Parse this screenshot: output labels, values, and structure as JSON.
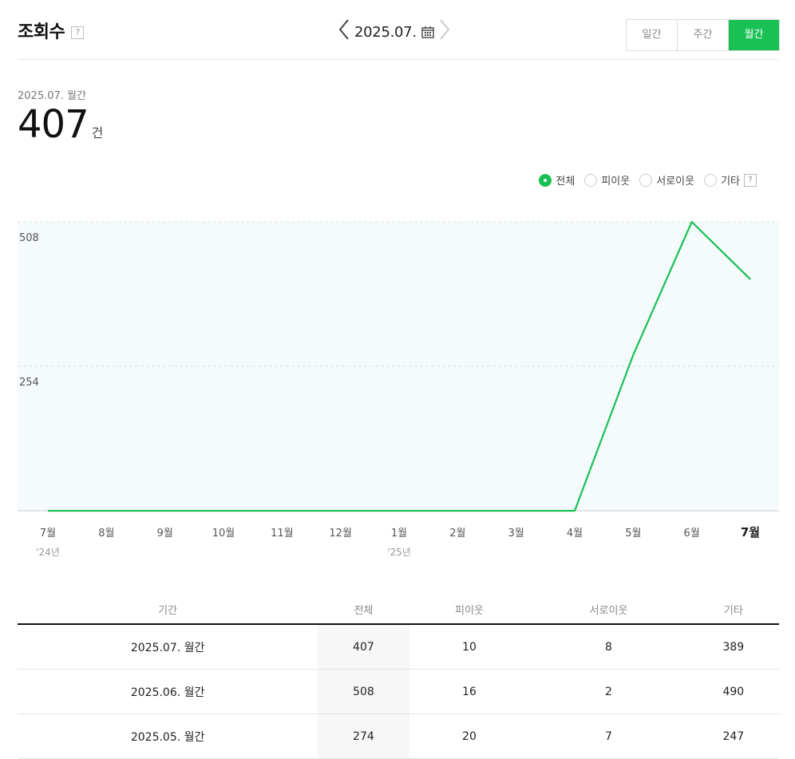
{
  "header": {
    "title": "조회수",
    "help": "?",
    "date_label": "2025.07.",
    "prev_arrow": "〈",
    "next_arrow": "〉",
    "tabs": [
      "일간",
      "주간",
      "월간"
    ],
    "active_tab": "월간"
  },
  "summary": {
    "period": "2025.07. 월간",
    "count": "407",
    "unit": "건"
  },
  "legend": {
    "items": [
      "전체",
      "피이웃",
      "서로이웃",
      "기타"
    ],
    "selected": "전체",
    "help": "?"
  },
  "colors": {
    "accent": "#19c154",
    "chart_bg": "#f5fafd"
  },
  "chart_data": {
    "type": "line",
    "categories": [
      "7월",
      "8월",
      "9월",
      "10월",
      "11월",
      "12월",
      "1월",
      "2월",
      "3월",
      "4월",
      "5월",
      "6월",
      "7월"
    ],
    "year_labels": [
      {
        "index": 0,
        "label": "'24년"
      },
      {
        "index": 6,
        "label": "'25년"
      }
    ],
    "series": [
      {
        "values": [
          0,
          0,
          0,
          0,
          0,
          0,
          0,
          0,
          0,
          0,
          274,
          508,
          407
        ]
      }
    ],
    "y_ticks": [
      "254",
      "508"
    ],
    "ylim": [
      0,
      508
    ],
    "grid": true
  },
  "table": {
    "headers": [
      "기간",
      "전체",
      "피이웃",
      "서로이웃",
      "기타"
    ],
    "rows": [
      [
        "2025.07. 월간",
        "407",
        "10",
        "8",
        "389"
      ],
      [
        "2025.06. 월간",
        "508",
        "16",
        "2",
        "490"
      ],
      [
        "2025.05. 월간",
        "274",
        "20",
        "7",
        "247"
      ]
    ]
  }
}
